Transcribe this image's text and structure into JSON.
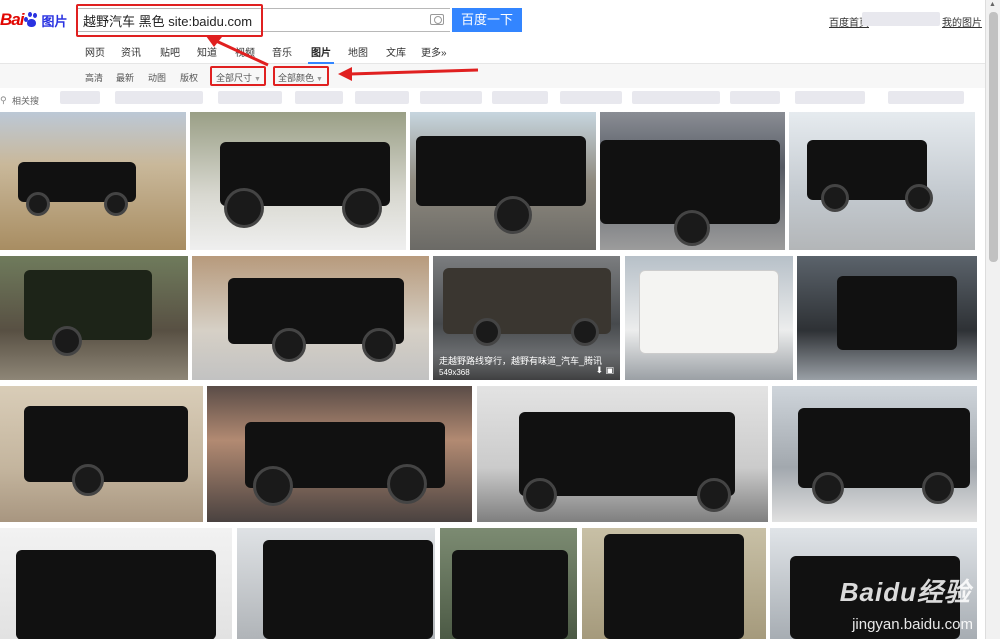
{
  "header": {
    "logo_bai": "Bai",
    "logo_du": "du",
    "logo_tupian": "图片",
    "search_value": "越野汽车 黑色 site:baidu.com",
    "search_button": "百度一下",
    "link_left": "百度首页",
    "link_right": "我的图片"
  },
  "nav": {
    "tabs": [
      {
        "label": "网页"
      },
      {
        "label": "资讯"
      },
      {
        "label": "贴吧"
      },
      {
        "label": "知道"
      },
      {
        "label": "视频"
      },
      {
        "label": "音乐"
      },
      {
        "label": "图片"
      },
      {
        "label": "地图"
      },
      {
        "label": "文库"
      },
      {
        "label": "更多»"
      }
    ]
  },
  "filters": {
    "items": [
      {
        "label": "高清"
      },
      {
        "label": "最新"
      },
      {
        "label": "动图"
      },
      {
        "label": "版权"
      }
    ],
    "size_dropdown": "全部尺寸",
    "color_dropdown": "全部颜色"
  },
  "related": {
    "label": "相关搜"
  },
  "images": {
    "hover_caption": "走越野路线穿行，越野有味道_汽车_腾讯",
    "hover_dim": "549x368"
  },
  "watermark": {
    "main": "Baidu经验",
    "sub": "jingyan.baidu.com"
  },
  "colors": {
    "brand_red": "#e10602",
    "brand_blue": "#2932e1",
    "button_blue": "#3385ff",
    "annotation_red": "#e02020"
  }
}
